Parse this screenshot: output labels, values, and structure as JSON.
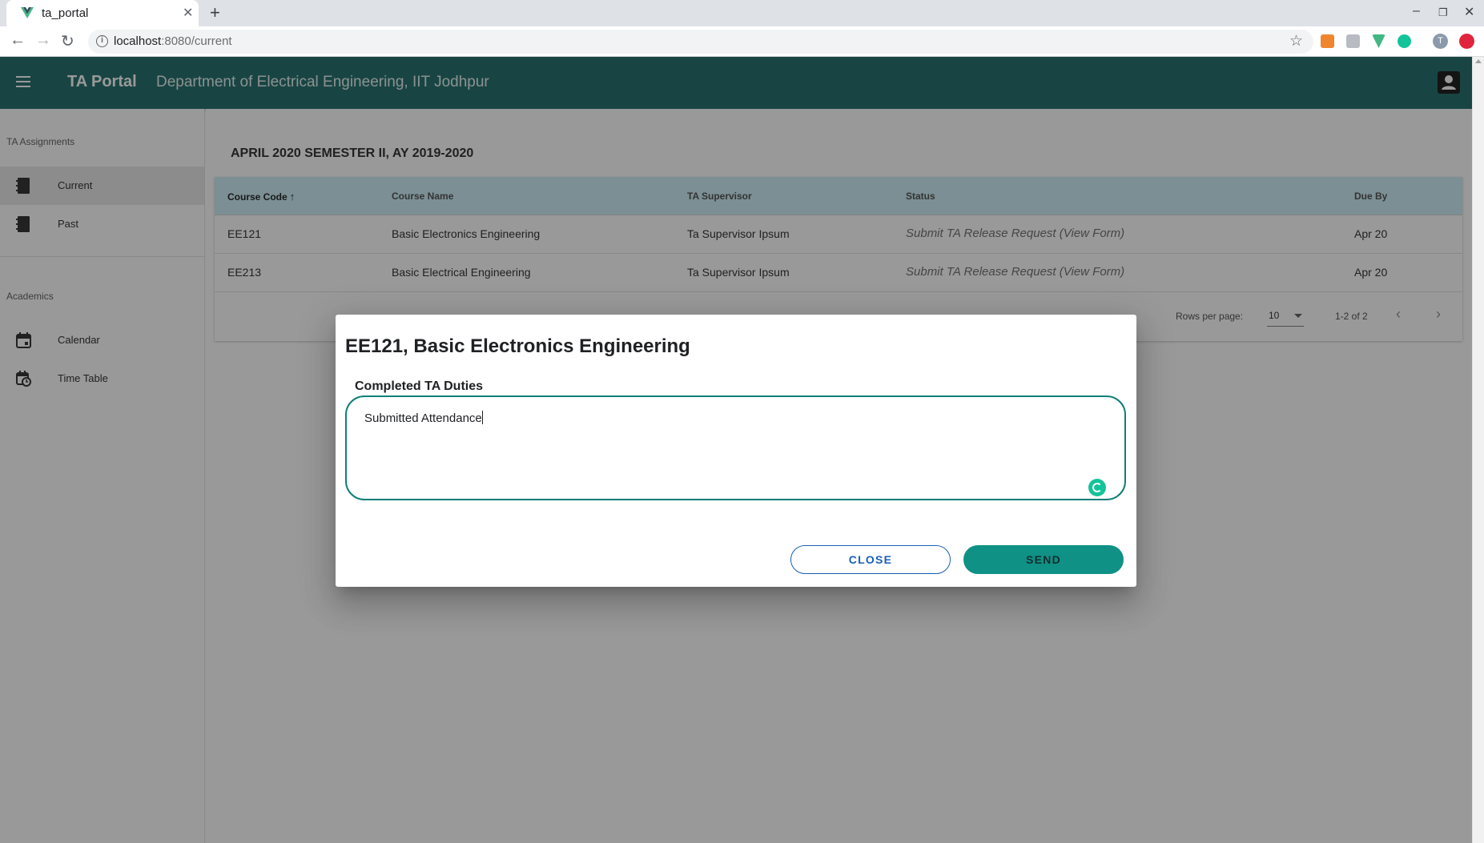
{
  "browser": {
    "tab_title": "ta_portal",
    "url_host": "localhost",
    "url_path": ":8080/current",
    "profile_initial": "T"
  },
  "app": {
    "title": "TA Portal",
    "subtitle": "Department of Electrical Engineering, IIT Jodhpur",
    "accent_color": "#116461"
  },
  "sidebar": {
    "section1": "TA Assignments",
    "items1": [
      {
        "label": "Current",
        "icon": "book-icon",
        "active": true
      },
      {
        "label": "Past",
        "icon": "book-icon",
        "active": false
      }
    ],
    "section2": "Academics",
    "items2": [
      {
        "label": "Calendar",
        "icon": "calendar-icon"
      },
      {
        "label": "Time Table",
        "icon": "calendar-clock-icon"
      }
    ]
  },
  "main": {
    "semester_title": "APRIL 2020 SEMESTER II, AY 2019-2020",
    "table": {
      "headers": [
        "Course Code",
        "Course Name",
        "TA Supervisor",
        "Status",
        "Due By"
      ],
      "rows": [
        [
          "EE121",
          "Basic Electronics Engineering",
          "Ta Supervisor Ipsum",
          "Submit TA Release Request (View Form)",
          "Apr 20"
        ],
        [
          "EE213",
          "Basic Electrical Engineering",
          "Ta Supervisor Ipsum",
          "Submit TA Release Request (View Form)",
          "Apr 20"
        ]
      ],
      "rows_per_page_label": "Rows per page:",
      "rows_per_page_value": "10",
      "range": "1-2 of 2"
    }
  },
  "dialog": {
    "title": "EE121, Basic Electronics Engineering",
    "field_label": "Completed TA Duties",
    "field_value": "Submitted Attendance",
    "close_label": "CLOSE",
    "send_label": "SEND"
  }
}
